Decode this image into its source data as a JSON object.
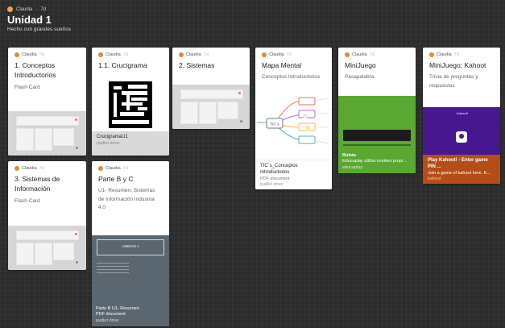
{
  "header": {
    "user": "Claudia",
    "age": "7d",
    "title": "Unidad 1",
    "subtitle": "Hecho con grandes sueños"
  },
  "cards": {
    "c1": {
      "author": "Claudia",
      "age": "7d",
      "title": "1. Conceptos Introductorios",
      "desc": "Flash Card"
    },
    "c2": {
      "author": "Claudia",
      "age": "7d",
      "title": "1.1. Crucigrama",
      "file": "CrucigramaU1",
      "source": "padlet drive"
    },
    "c3": {
      "author": "Claudia",
      "age": "7d",
      "title": "2. Sistemas"
    },
    "c4": {
      "author": "Claudia",
      "age": "7d",
      "title": "Mapa Mental",
      "desc": "Conceptos Introductorios",
      "file": "TIC´s_Conceptos Introductorios",
      "type": "PDF document",
      "source": "padlet drive",
      "map_center": "TIC´s"
    },
    "c5": {
      "author": "Claudia",
      "age": "7d",
      "title": "MiniJuego",
      "desc": "Pasapalabra",
      "file": "Ruleta",
      "preview": "Educaplay utiliza cookies propi...",
      "source": "educaplay"
    },
    "c6": {
      "author": "Claudia",
      "age": "7d",
      "title": "MiniJuego: Kahoot",
      "desc": "Trivia de preguntas y respuestas",
      "file": "Play Kahoot! - Enter game PIN ...",
      "preview": "Join a game of kahoot here. K...",
      "source": "kahoot",
      "brand": "Kahoot!"
    },
    "c7": {
      "author": "Claudia",
      "age": "7d",
      "title": "3. Sistemas de Información",
      "desc": "Flash Card"
    },
    "c8": {
      "author": "Claudia",
      "age": "7d",
      "title": "Parte B y C",
      "desc": "U1- Resumen. Sistemas de Información Industria 4.0",
      "slide": "UNIDAD 1",
      "file": "Parte B U1- Resumen",
      "type": "PDF document",
      "source": "padlet drive"
    }
  },
  "colors": {
    "bg": "#2c2c2c",
    "edu_green": "#5aa832",
    "kahoot_purple": "#46178f",
    "kahoot_orange": "#b44d18",
    "slate": "#5b6770"
  }
}
